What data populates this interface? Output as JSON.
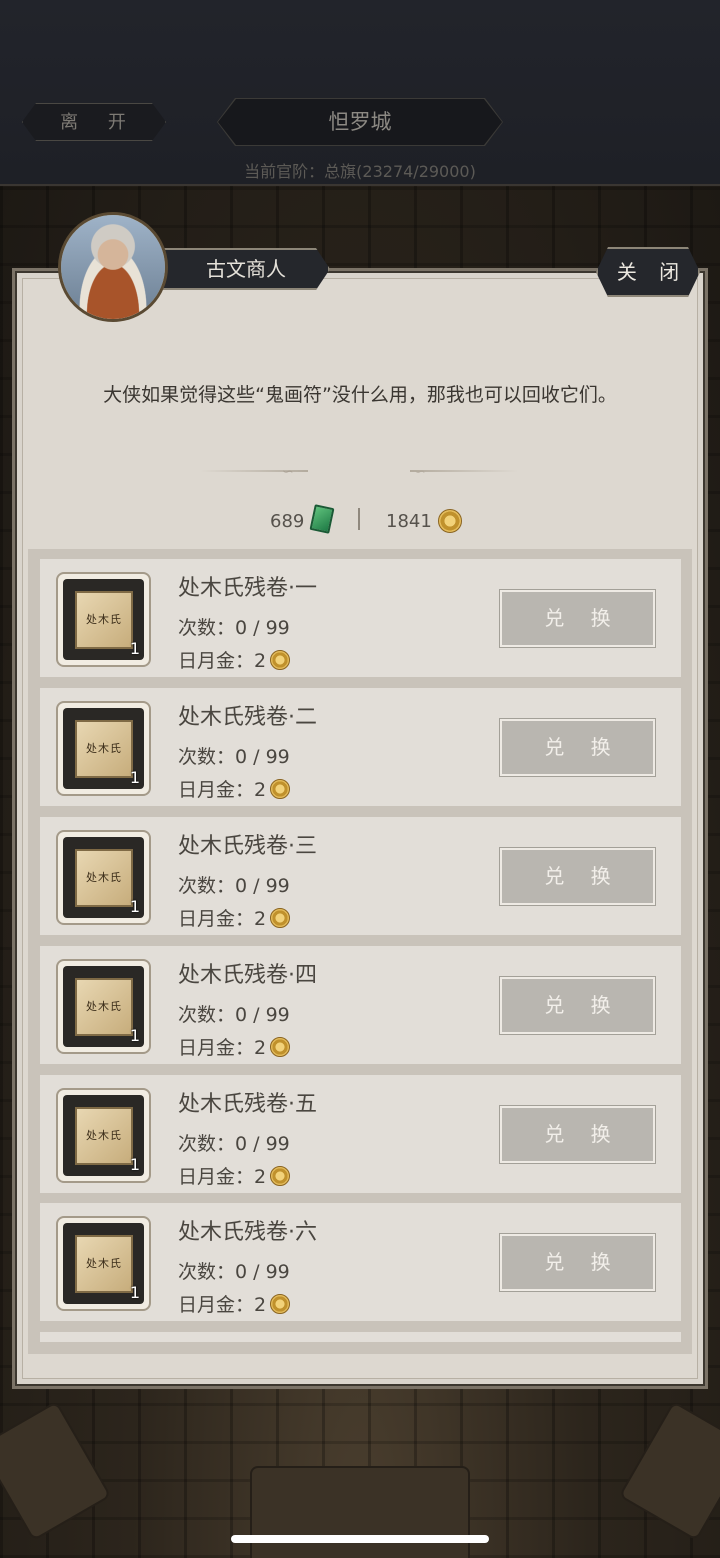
{
  "topbar": {
    "leave_label": "离 开",
    "city_name": "怛罗城",
    "rank_text": "当前官阶：总旗(23274/29000)"
  },
  "dialog": {
    "npc_name": "古文商人",
    "close_label": "关 闭",
    "message": "大侠如果觉得这些“鬼画符”没什么用，那我也可以回收它们。"
  },
  "currency": {
    "jade_amount": "689",
    "gold_amount": "1841",
    "jade_icon": "jade-token-icon",
    "gold_icon": "gold-coin-icon"
  },
  "items": [
    {
      "name": "处木氏残卷·一",
      "count_line": "次数：0 / 99",
      "price_label": "日月金：",
      "price": "2",
      "qty": "1",
      "button": "兑 换",
      "scroll_text": "处木氏"
    },
    {
      "name": "处木氏残卷·二",
      "count_line": "次数：0 / 99",
      "price_label": "日月金：",
      "price": "2",
      "qty": "1",
      "button": "兑 换",
      "scroll_text": "处木氏"
    },
    {
      "name": "处木氏残卷·三",
      "count_line": "次数：0 / 99",
      "price_label": "日月金：",
      "price": "2",
      "qty": "1",
      "button": "兑 换",
      "scroll_text": "处木氏"
    },
    {
      "name": "处木氏残卷·四",
      "count_line": "次数：0 / 99",
      "price_label": "日月金：",
      "price": "2",
      "qty": "1",
      "button": "兑 换",
      "scroll_text": "处木氏"
    },
    {
      "name": "处木氏残卷·五",
      "count_line": "次数：0 / 99",
      "price_label": "日月金：",
      "price": "2",
      "qty": "1",
      "button": "兑 换",
      "scroll_text": "处木氏"
    },
    {
      "name": "处木氏残卷·六",
      "count_line": "次数：0 / 99",
      "price_label": "日月金：",
      "price": "2",
      "qty": "1",
      "button": "兑 换",
      "scroll_text": "处木氏"
    }
  ]
}
